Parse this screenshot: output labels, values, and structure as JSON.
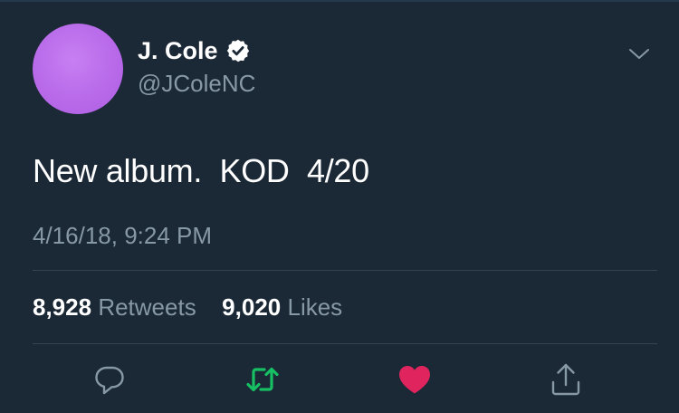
{
  "user": {
    "display_name": "J. Cole",
    "handle": "@JColeNC",
    "verified": true,
    "avatar_color": "#b86ae9"
  },
  "tweet": {
    "text": "New album.  KOD  4/20",
    "timestamp": "4/16/18, 9:24 PM"
  },
  "stats": {
    "retweets_count": "8,928",
    "retweets_label": "Retweets",
    "likes_count": "9,020",
    "likes_label": "Likes"
  },
  "actions": [
    {
      "name": "reply",
      "icon": "reply-icon",
      "color": "#8899a6"
    },
    {
      "name": "retweet",
      "icon": "retweet-icon",
      "color": "#17bf63",
      "active": true
    },
    {
      "name": "like",
      "icon": "heart-icon",
      "color": "#e0245e",
      "active": true
    },
    {
      "name": "share",
      "icon": "share-icon",
      "color": "#8899a6"
    }
  ],
  "colors": {
    "background": "#1b2836",
    "text_primary": "#ffffff",
    "text_secondary": "#8899a6",
    "divider": "#38444d"
  }
}
